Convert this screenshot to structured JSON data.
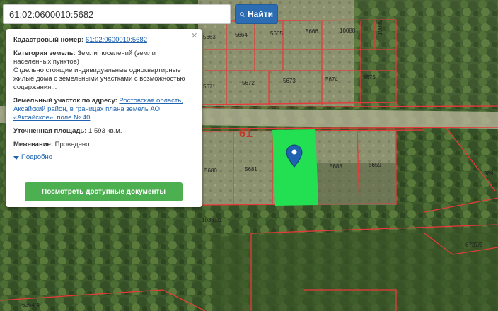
{
  "search": {
    "value": "61:02:0600010:5682",
    "button_label": "Найти"
  },
  "panel": {
    "cadastral_label": "Кадастровый номер:",
    "cadastral_value": "61:02:0600010:5682",
    "category_label": "Категория земель:",
    "category_value": "Земли поселений (земли населенных пунктов)",
    "usage_text": "Отдельно стоящие индивидуальные одноквартирные жилые дома с земельными участками с возможностью содержания...",
    "address_label": "Земельный участок по адресу:",
    "address_value": "Ростовская область, Аксайский район, в границах плана земель АО «Аксайское», поле № 40",
    "area_label": "Уточненная площадь:",
    "area_value": "1 593 кв.м.",
    "survey_label": "Межевание:",
    "survey_value": "Проведено",
    "more_label": "Подробно",
    "docs_button": "Посмотреть доступные документы",
    "close_symbol": "×"
  },
  "map": {
    "street_label": "61",
    "parcels": [
      "5663",
      "5664",
      "5665",
      "5666",
      "10088",
      "10089",
      "5671",
      "5672",
      "5673",
      "5674",
      "5675",
      "5680",
      "5681",
      "5683",
      "5659",
      "10331/1",
      "989",
      "6727/3",
      "6364/4"
    ],
    "icons": [
      "search-icon",
      "map-marker-icon",
      "close-icon",
      "chevron-down-icon"
    ],
    "colors": {
      "selected_parcel": "#22e052",
      "boundary": "#e83a3a",
      "button_blue": "#2b6cb3",
      "button_green": "#4caf50",
      "link": "#1e62b0"
    }
  }
}
